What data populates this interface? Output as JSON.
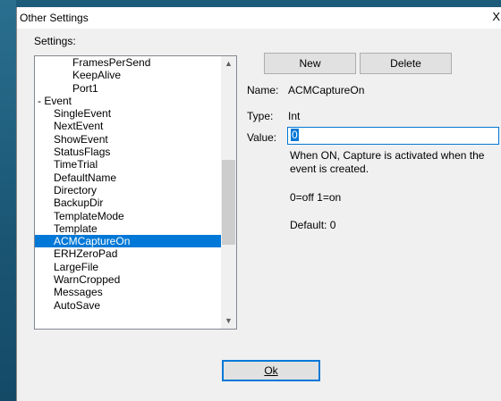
{
  "window": {
    "title": "Other Settings",
    "close_glyph": "X"
  },
  "settings": {
    "label": "Settings:",
    "items": [
      {
        "text": "FramesPerSend",
        "level": "indent"
      },
      {
        "text": "KeepAlive",
        "level": "indent"
      },
      {
        "text": "Port1",
        "level": "indent"
      },
      {
        "text": "-  Event",
        "level": "group"
      },
      {
        "text": "SingleEvent",
        "level": "child"
      },
      {
        "text": "NextEvent",
        "level": "child"
      },
      {
        "text": "ShowEvent",
        "level": "child"
      },
      {
        "text": "StatusFlags",
        "level": "child"
      },
      {
        "text": "TimeTrial",
        "level": "child"
      },
      {
        "text": "DefaultName",
        "level": "child"
      },
      {
        "text": "Directory",
        "level": "child"
      },
      {
        "text": "BackupDir",
        "level": "child"
      },
      {
        "text": "TemplateMode",
        "level": "child"
      },
      {
        "text": "Template",
        "level": "child"
      },
      {
        "text": "ACMCaptureOn",
        "level": "child",
        "selected": true
      },
      {
        "text": "ERHZeroPad",
        "level": "child"
      },
      {
        "text": "LargeFile",
        "level": "child"
      },
      {
        "text": "WarnCropped",
        "level": "child"
      },
      {
        "text": "Messages",
        "level": "child"
      },
      {
        "text": "AutoSave",
        "level": "child"
      }
    ]
  },
  "buttons": {
    "new_label": "New",
    "delete_label": "Delete",
    "ok_label": "Ok"
  },
  "detail": {
    "name_label": "Name:",
    "name_value": "ACMCaptureOn",
    "type_label": "Type:",
    "type_value": "Int",
    "value_label": "Value:",
    "value_value": "0",
    "description": "When ON, Capture is activated when the event is created.",
    "hint": "0=off 1=on",
    "default": "Default: 0"
  },
  "icons": {
    "scroll_up": "chevron-up-icon",
    "scroll_down": "chevron-down-icon"
  },
  "colors": {
    "selection": "#0078d7",
    "desktop": "#1f5a78"
  }
}
